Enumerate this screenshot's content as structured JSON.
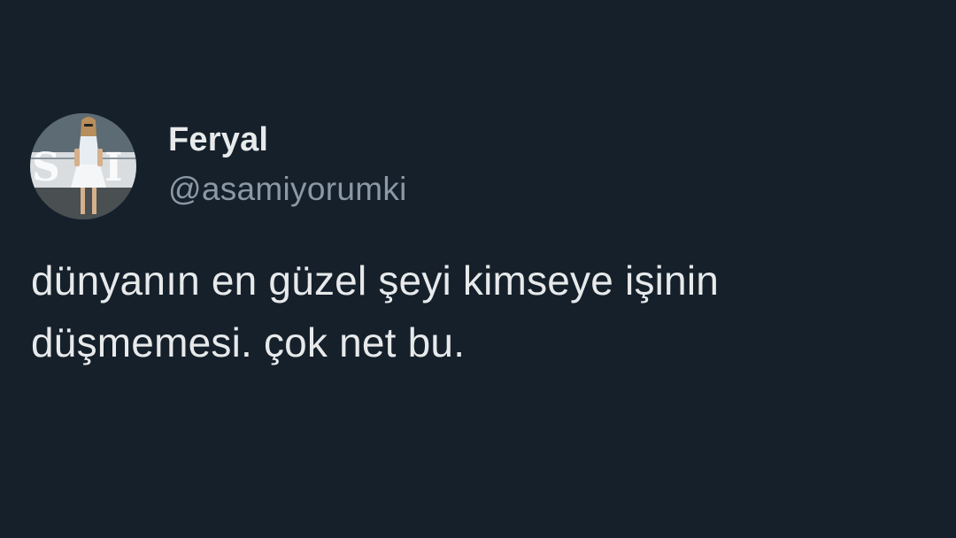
{
  "tweet": {
    "author": {
      "display_name": "Feryal",
      "handle": "@asamiyorumki",
      "avatar_icon": "profile-photo"
    },
    "text_lines": [
      "dünyanın en güzel şeyi kimseye işinin",
      "düşmemesi. çok net bu."
    ]
  },
  "colors": {
    "background": "#15202b",
    "primary_text": "#e7e9ea",
    "secondary_text": "#8b98a5"
  }
}
